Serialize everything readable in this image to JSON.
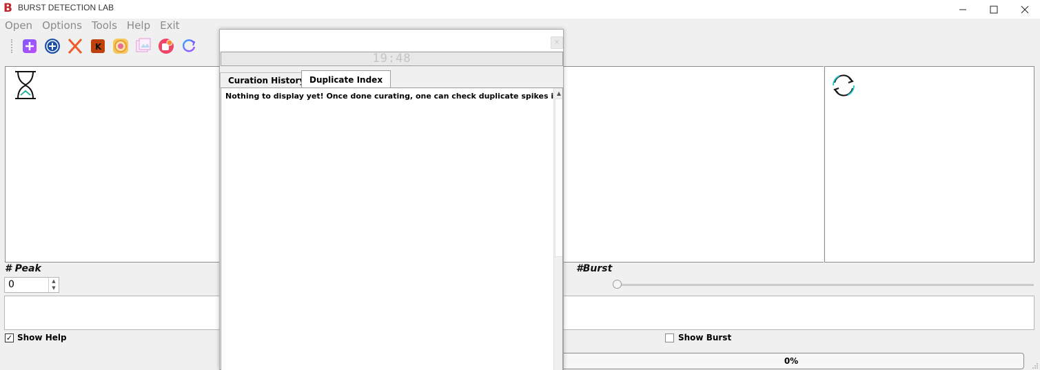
{
  "window": {
    "title": "BURST DETECTION LAB",
    "logo_letter": "B",
    "controls": {
      "minimize": "—",
      "maximize": "☐",
      "close": "✕"
    }
  },
  "menu": [
    "Open",
    "Options",
    "Tools",
    "Help",
    "Exit"
  ],
  "toolbar": {
    "icons": [
      "add-icon",
      "plus-circle-icon",
      "delete-x-icon",
      "k-box-icon",
      "color-wheel-icon",
      "image-gallery-icon",
      "settings-badge-icon",
      "refresh-icon"
    ]
  },
  "labels": {
    "peak": "# Peak",
    "burst": "#Burst"
  },
  "peak_spin": {
    "value": "0"
  },
  "burst_slider": {
    "value_fraction": 0.0
  },
  "checkboxes": {
    "show_help": {
      "label": "Show Help",
      "checked": true
    },
    "show_burst": {
      "label": "Show Burst",
      "checked": false
    }
  },
  "progress": {
    "text": "0%",
    "percent": 0
  },
  "dialog": {
    "clock": "19:48",
    "close_glyph": "✕",
    "tabs": [
      {
        "label": "Curation History",
        "active": false
      },
      {
        "label": "Duplicate Index",
        "active": true
      }
    ],
    "panel_text": "Nothing to display yet! Once done curating, one can check duplicate spikes in curated"
  },
  "colors": {
    "brand": "#c0272d",
    "progress_fill": "#1e90ff",
    "menu_text": "#8a8a8a"
  }
}
